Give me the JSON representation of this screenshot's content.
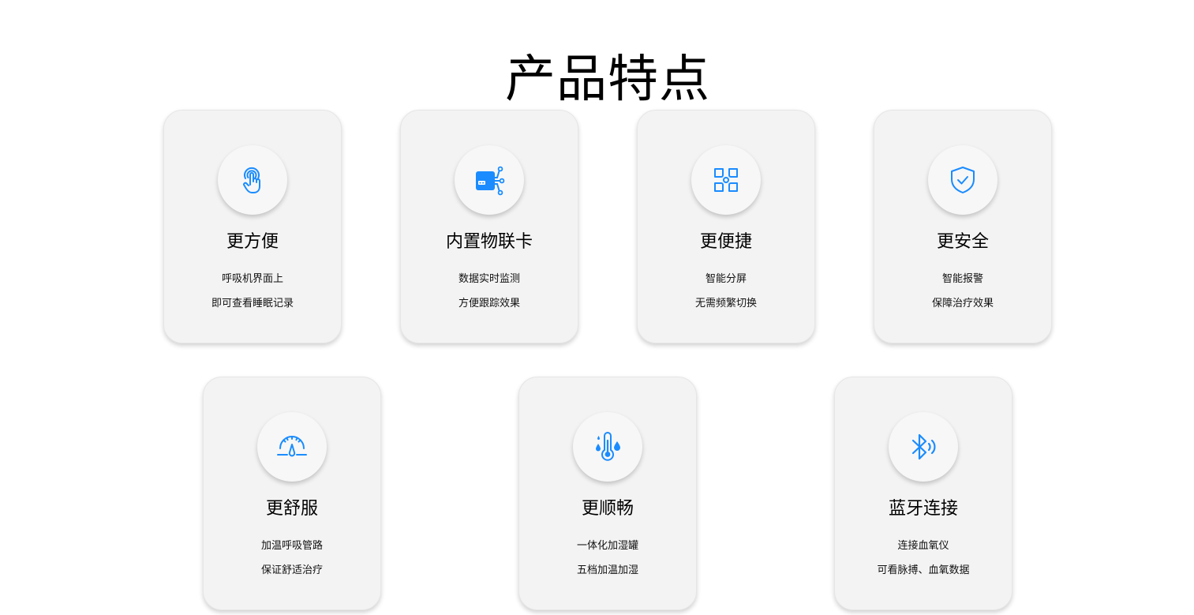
{
  "page": {
    "title": "产品特点"
  },
  "colors": {
    "accent": "#1a8cff",
    "card_bg": "#f3f3f3",
    "circle_bg": "#f7f7f7"
  },
  "features": [
    {
      "icon": "touch-icon",
      "title": "更方便",
      "line1": "呼吸机界面上",
      "line2": "即可查看睡眠记录"
    },
    {
      "icon": "iot-card-icon",
      "title": "内置物联卡",
      "line1": "数据实时监测",
      "line2": "方便跟踪效果"
    },
    {
      "icon": "split-screen-icon",
      "title": "更便捷",
      "line1": "智能分屏",
      "line2": "无需频繁切换"
    },
    {
      "icon": "shield-check-icon",
      "title": "更安全",
      "line1": "智能报警",
      "line2": "保障治疗效果"
    },
    {
      "icon": "gauge-icon",
      "title": "更舒服",
      "line1": "加温呼吸管路",
      "line2": "保证舒适治疗"
    },
    {
      "icon": "thermometer-drops-icon",
      "title": "更顺畅",
      "line1": "一体化加湿罐",
      "line2": "五档加温加湿"
    },
    {
      "icon": "bluetooth-icon",
      "title": "蓝牙连接",
      "line1": "连接血氧仪",
      "line2": "可看脉搏、血氧数据"
    }
  ]
}
